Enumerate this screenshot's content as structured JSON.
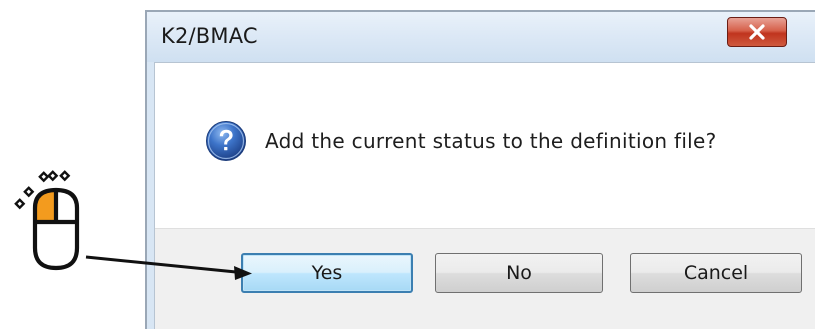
{
  "dialog": {
    "title": "K2/BMAC",
    "message": "Add the current status to the definition file?",
    "icon": "question-icon",
    "close_icon": "close-icon"
  },
  "buttons": {
    "yes_label": "Yes",
    "no_label": "No",
    "cancel_label": "Cancel",
    "default": "Yes"
  },
  "annotation": {
    "mouse_icon": "mouse-left-click-icon",
    "pointer": "arrow-to-yes-button",
    "highlight_color": "#f39b1e"
  },
  "colors": {
    "close_button": "#c94a35",
    "default_button_border": "#3c7fb1",
    "question_icon": "#2a5fb0"
  }
}
